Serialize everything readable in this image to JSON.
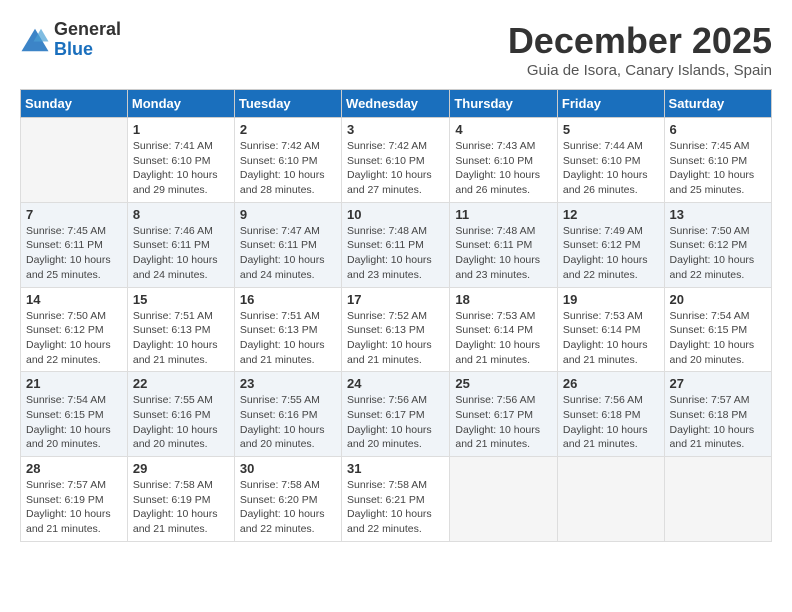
{
  "logo": {
    "general": "General",
    "blue": "Blue"
  },
  "title": "December 2025",
  "location": "Guia de Isora, Canary Islands, Spain",
  "days_of_week": [
    "Sunday",
    "Monday",
    "Tuesday",
    "Wednesday",
    "Thursday",
    "Friday",
    "Saturday"
  ],
  "weeks": [
    [
      {
        "day": "",
        "info": ""
      },
      {
        "day": "1",
        "info": "Sunrise: 7:41 AM\nSunset: 6:10 PM\nDaylight: 10 hours\nand 29 minutes."
      },
      {
        "day": "2",
        "info": "Sunrise: 7:42 AM\nSunset: 6:10 PM\nDaylight: 10 hours\nand 28 minutes."
      },
      {
        "day": "3",
        "info": "Sunrise: 7:42 AM\nSunset: 6:10 PM\nDaylight: 10 hours\nand 27 minutes."
      },
      {
        "day": "4",
        "info": "Sunrise: 7:43 AM\nSunset: 6:10 PM\nDaylight: 10 hours\nand 26 minutes."
      },
      {
        "day": "5",
        "info": "Sunrise: 7:44 AM\nSunset: 6:10 PM\nDaylight: 10 hours\nand 26 minutes."
      },
      {
        "day": "6",
        "info": "Sunrise: 7:45 AM\nSunset: 6:10 PM\nDaylight: 10 hours\nand 25 minutes."
      }
    ],
    [
      {
        "day": "7",
        "info": "Sunrise: 7:45 AM\nSunset: 6:11 PM\nDaylight: 10 hours\nand 25 minutes."
      },
      {
        "day": "8",
        "info": "Sunrise: 7:46 AM\nSunset: 6:11 PM\nDaylight: 10 hours\nand 24 minutes."
      },
      {
        "day": "9",
        "info": "Sunrise: 7:47 AM\nSunset: 6:11 PM\nDaylight: 10 hours\nand 24 minutes."
      },
      {
        "day": "10",
        "info": "Sunrise: 7:48 AM\nSunset: 6:11 PM\nDaylight: 10 hours\nand 23 minutes."
      },
      {
        "day": "11",
        "info": "Sunrise: 7:48 AM\nSunset: 6:11 PM\nDaylight: 10 hours\nand 23 minutes."
      },
      {
        "day": "12",
        "info": "Sunrise: 7:49 AM\nSunset: 6:12 PM\nDaylight: 10 hours\nand 22 minutes."
      },
      {
        "day": "13",
        "info": "Sunrise: 7:50 AM\nSunset: 6:12 PM\nDaylight: 10 hours\nand 22 minutes."
      }
    ],
    [
      {
        "day": "14",
        "info": "Sunrise: 7:50 AM\nSunset: 6:12 PM\nDaylight: 10 hours\nand 22 minutes."
      },
      {
        "day": "15",
        "info": "Sunrise: 7:51 AM\nSunset: 6:13 PM\nDaylight: 10 hours\nand 21 minutes."
      },
      {
        "day": "16",
        "info": "Sunrise: 7:51 AM\nSunset: 6:13 PM\nDaylight: 10 hours\nand 21 minutes."
      },
      {
        "day": "17",
        "info": "Sunrise: 7:52 AM\nSunset: 6:13 PM\nDaylight: 10 hours\nand 21 minutes."
      },
      {
        "day": "18",
        "info": "Sunrise: 7:53 AM\nSunset: 6:14 PM\nDaylight: 10 hours\nand 21 minutes."
      },
      {
        "day": "19",
        "info": "Sunrise: 7:53 AM\nSunset: 6:14 PM\nDaylight: 10 hours\nand 21 minutes."
      },
      {
        "day": "20",
        "info": "Sunrise: 7:54 AM\nSunset: 6:15 PM\nDaylight: 10 hours\nand 20 minutes."
      }
    ],
    [
      {
        "day": "21",
        "info": "Sunrise: 7:54 AM\nSunset: 6:15 PM\nDaylight: 10 hours\nand 20 minutes."
      },
      {
        "day": "22",
        "info": "Sunrise: 7:55 AM\nSunset: 6:16 PM\nDaylight: 10 hours\nand 20 minutes."
      },
      {
        "day": "23",
        "info": "Sunrise: 7:55 AM\nSunset: 6:16 PM\nDaylight: 10 hours\nand 20 minutes."
      },
      {
        "day": "24",
        "info": "Sunrise: 7:56 AM\nSunset: 6:17 PM\nDaylight: 10 hours\nand 20 minutes."
      },
      {
        "day": "25",
        "info": "Sunrise: 7:56 AM\nSunset: 6:17 PM\nDaylight: 10 hours\nand 21 minutes."
      },
      {
        "day": "26",
        "info": "Sunrise: 7:56 AM\nSunset: 6:18 PM\nDaylight: 10 hours\nand 21 minutes."
      },
      {
        "day": "27",
        "info": "Sunrise: 7:57 AM\nSunset: 6:18 PM\nDaylight: 10 hours\nand 21 minutes."
      }
    ],
    [
      {
        "day": "28",
        "info": "Sunrise: 7:57 AM\nSunset: 6:19 PM\nDaylight: 10 hours\nand 21 minutes."
      },
      {
        "day": "29",
        "info": "Sunrise: 7:58 AM\nSunset: 6:19 PM\nDaylight: 10 hours\nand 21 minutes."
      },
      {
        "day": "30",
        "info": "Sunrise: 7:58 AM\nSunset: 6:20 PM\nDaylight: 10 hours\nand 22 minutes."
      },
      {
        "day": "31",
        "info": "Sunrise: 7:58 AM\nSunset: 6:21 PM\nDaylight: 10 hours\nand 22 minutes."
      },
      {
        "day": "",
        "info": ""
      },
      {
        "day": "",
        "info": ""
      },
      {
        "day": "",
        "info": ""
      }
    ]
  ]
}
